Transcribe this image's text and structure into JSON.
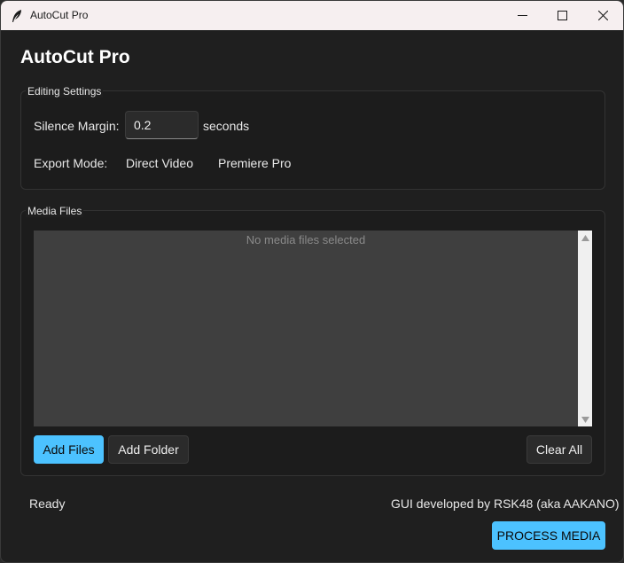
{
  "window": {
    "title": "AutoCut Pro",
    "icon": "feather-icon",
    "controls": [
      "minimize-icon",
      "maximize-icon",
      "close-icon"
    ]
  },
  "app_title": "AutoCut Pro",
  "editing_settings": {
    "group_label": "Editing Settings",
    "silence_margin_label": "Silence Margin:",
    "silence_margin_value": "0.2",
    "silence_margin_unit": "seconds",
    "export_mode_label": "Export Mode:",
    "export_modes": [
      "Direct Video",
      "Premiere Pro"
    ]
  },
  "media_files": {
    "group_label": "Media Files",
    "empty_text": "No media files selected",
    "add_files_label": "Add Files",
    "add_folder_label": "Add Folder",
    "clear_all_label": "Clear All"
  },
  "footer": {
    "status": "Ready",
    "credit": "GUI developed by RSK48 (aka AAKANO)",
    "process_label": "PROCESS MEDIA"
  },
  "colors": {
    "accent": "#4cc2ff",
    "background": "#1f1f1f",
    "titlebar": "#f6eff0",
    "list_background": "#3f3f3f"
  }
}
